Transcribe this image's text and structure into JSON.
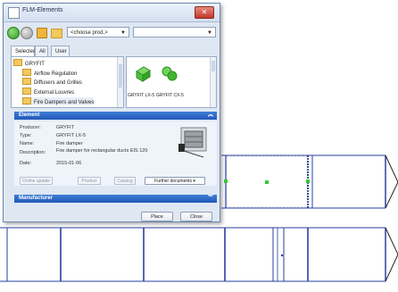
{
  "window": {
    "title": "FLM-Elements",
    "close_glyph": "✕"
  },
  "toolbar": {
    "icons": [
      "green-circle-icon",
      "gray-circle-icon",
      "home-icon",
      "folder-open-icon"
    ],
    "producer_combo": "<choose prod.>",
    "second_combo": ""
  },
  "tabs": [
    "Selected",
    "All",
    "User"
  ],
  "tree": {
    "root": "GRYFIT",
    "items": [
      "Airflow Regulation",
      "Diffusers and Grilles",
      "External Louvres",
      "Fire Dampers and Valves"
    ]
  },
  "products": [
    {
      "label": "GRYFIT LX-5",
      "icon": "green-cube-icon"
    },
    {
      "label": "GRYFIT CX-5",
      "icon": "green-cube-icon"
    }
  ],
  "element": {
    "header": "Element",
    "fields": [
      {
        "label": "Producer:",
        "value": "GRYFIT"
      },
      {
        "label": "Type:",
        "value": "GRYFIT LX-5"
      },
      {
        "label": "Name:",
        "value": "Fire damper"
      },
      {
        "label": "Description:",
        "value": "Fire damper for rectangular ducts EIS 120"
      },
      {
        "label": "Date:",
        "value": "2015-01-06"
      }
    ],
    "buttons": [
      "Online update",
      "Product",
      "Catalog",
      "Further documents"
    ]
  },
  "manufacturer": {
    "header": "Manufacturer"
  },
  "footer": {
    "place": "Place",
    "close": "Close"
  },
  "colors": {
    "accent": "#2a64c4",
    "duct_line": "#2a3fa0",
    "selection_green": "#33cc33"
  }
}
